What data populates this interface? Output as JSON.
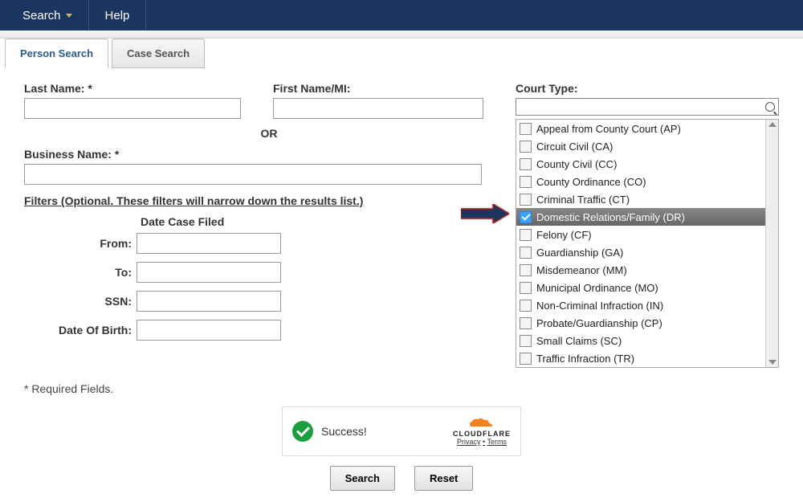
{
  "nav": {
    "search": "Search",
    "help": "Help"
  },
  "tabs": {
    "person": "Person Search",
    "case": "Case Search"
  },
  "form": {
    "lastname_label": "Last Name: *",
    "firstname_label": "First Name/MI:",
    "or": "OR",
    "business_label": "Business Name: *",
    "filters_head": "Filters (Optional. These filters will narrow down the results list.)",
    "date_filed_title": "Date Case Filed",
    "from_label": "From:",
    "to_label": "To:",
    "ssn_label": "SSN:",
    "dob_label": "Date Of Birth:"
  },
  "court": {
    "label": "Court Type:",
    "items": [
      {
        "label": "Appeal from County Court (AP)",
        "checked": false
      },
      {
        "label": "Circuit Civil (CA)",
        "checked": false
      },
      {
        "label": "County Civil (CC)",
        "checked": false
      },
      {
        "label": "County Ordinance (CO)",
        "checked": false
      },
      {
        "label": "Criminal Traffic (CT)",
        "checked": false
      },
      {
        "label": "Domestic Relations/Family (DR)",
        "checked": true
      },
      {
        "label": "Felony (CF)",
        "checked": false
      },
      {
        "label": "Guardianship (GA)",
        "checked": false
      },
      {
        "label": "Misdemeanor (MM)",
        "checked": false
      },
      {
        "label": "Municipal Ordinance (MO)",
        "checked": false
      },
      {
        "label": "Non-Criminal Infraction (IN)",
        "checked": false
      },
      {
        "label": "Probate/Guardianship (CP)",
        "checked": false
      },
      {
        "label": "Small Claims (SC)",
        "checked": false
      },
      {
        "label": "Traffic Infraction (TR)",
        "checked": false
      }
    ]
  },
  "reqnote": "* Required Fields.",
  "captcha": {
    "success": "Success!",
    "brand": "CLOUDFLARE",
    "privacy": "Privacy",
    "dot": "•",
    "terms": "Terms"
  },
  "buttons": {
    "search": "Search",
    "reset": "Reset"
  }
}
